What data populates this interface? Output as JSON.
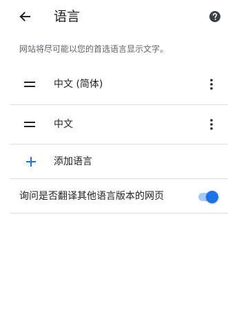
{
  "header": {
    "title": "语言",
    "back_icon": "arrow-back-icon",
    "help_icon": "help-icon"
  },
  "description": "网站将尽可能以您的首选语言显示文字。",
  "languages": [
    {
      "label": "中文 (简体)"
    },
    {
      "label": "中文"
    }
  ],
  "add_language": {
    "label": "添加语言",
    "icon": "plus-icon"
  },
  "translate_toggle": {
    "label": "询问是否翻译其他语言版本的网页",
    "checked": true
  },
  "colors": {
    "accent": "#1a73e8",
    "track_on": "#a8c7fa",
    "divider": "#e0e0e0",
    "secondary_text": "#5f6368"
  }
}
